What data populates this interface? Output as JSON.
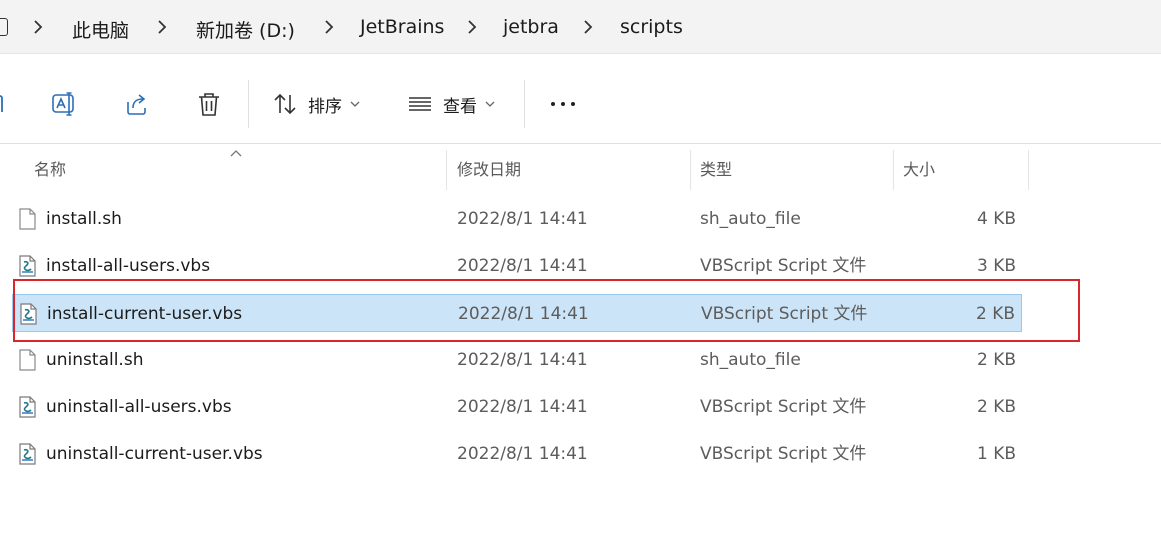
{
  "breadcrumb": {
    "items": [
      "此电脑",
      "新加卷 (D:)",
      "JetBrains",
      "jetbra",
      "scripts"
    ]
  },
  "toolbar": {
    "sort_label": "排序",
    "view_label": "查看",
    "more_label": "•••",
    "icons": [
      "rename-icon",
      "share-icon",
      "delete-icon",
      "sort-icon",
      "view-icon",
      "more-icon"
    ]
  },
  "columns": {
    "name": "名称",
    "date": "修改日期",
    "type": "类型",
    "size": "大小"
  },
  "files": [
    {
      "name": "install.sh",
      "date": "2022/8/1 14:41",
      "type": "sh_auto_file",
      "size": "4 KB",
      "icon": "generic-file-icon",
      "selected": false
    },
    {
      "name": "install-all-users.vbs",
      "date": "2022/8/1 14:41",
      "type": "VBScript Script 文件",
      "size": "3 KB",
      "icon": "vbs-script-icon",
      "selected": false
    },
    {
      "name": "install-current-user.vbs",
      "date": "2022/8/1 14:41",
      "type": "VBScript Script 文件",
      "size": "2 KB",
      "icon": "vbs-script-icon",
      "selected": true
    },
    {
      "name": "uninstall.sh",
      "date": "2022/8/1 14:41",
      "type": "sh_auto_file",
      "size": "2 KB",
      "icon": "generic-file-icon",
      "selected": false
    },
    {
      "name": "uninstall-all-users.vbs",
      "date": "2022/8/1 14:41",
      "type": "VBScript Script 文件",
      "size": "2 KB",
      "icon": "vbs-script-icon",
      "selected": false
    },
    {
      "name": "uninstall-current-user.vbs",
      "date": "2022/8/1 14:41",
      "type": "VBScript Script 文件",
      "size": "1 KB",
      "icon": "vbs-script-icon",
      "selected": false
    }
  ],
  "colors": {
    "selection_bg": "#cce4f7",
    "selection_border": "#99c9ef",
    "annotation_red": "#d9252b",
    "accent_blue": "#2c6fb7"
  }
}
